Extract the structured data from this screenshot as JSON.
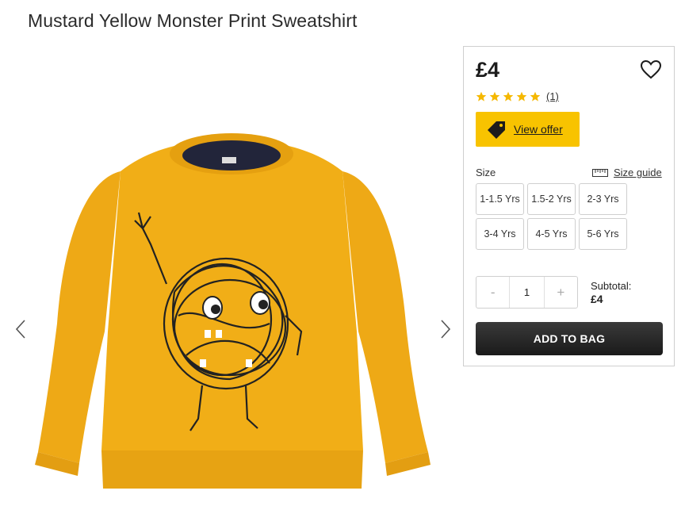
{
  "product": {
    "title": "Mustard Yellow Monster Print Sweatshirt",
    "price": "£4",
    "rating": {
      "stars": 5,
      "review_count": "(1)"
    },
    "offer_label": "View offer",
    "size_label": "Size",
    "size_guide_label": "Size guide",
    "sizes": [
      "1-1.5 Yrs",
      "1.5-2 Yrs",
      "2-3 Yrs",
      "3-4 Yrs",
      "4-5 Yrs",
      "5-6 Yrs"
    ],
    "quantity": {
      "minus": "-",
      "value": "1",
      "plus": "+"
    },
    "subtotal_label": "Subtotal:",
    "subtotal_value": "£4",
    "add_to_bag_label": "ADD TO BAG"
  },
  "colors": {
    "offer_yellow": "#f8c300",
    "star_yellow": "#f5b800",
    "sweatshirt_mustard": "#eeaa16",
    "button_dark": "#222222"
  },
  "icons": {
    "prev": "chevron-left-icon",
    "next": "chevron-right-icon",
    "wishlist": "heart-icon",
    "offer": "tag-icon",
    "size_guide": "ruler-icon"
  }
}
